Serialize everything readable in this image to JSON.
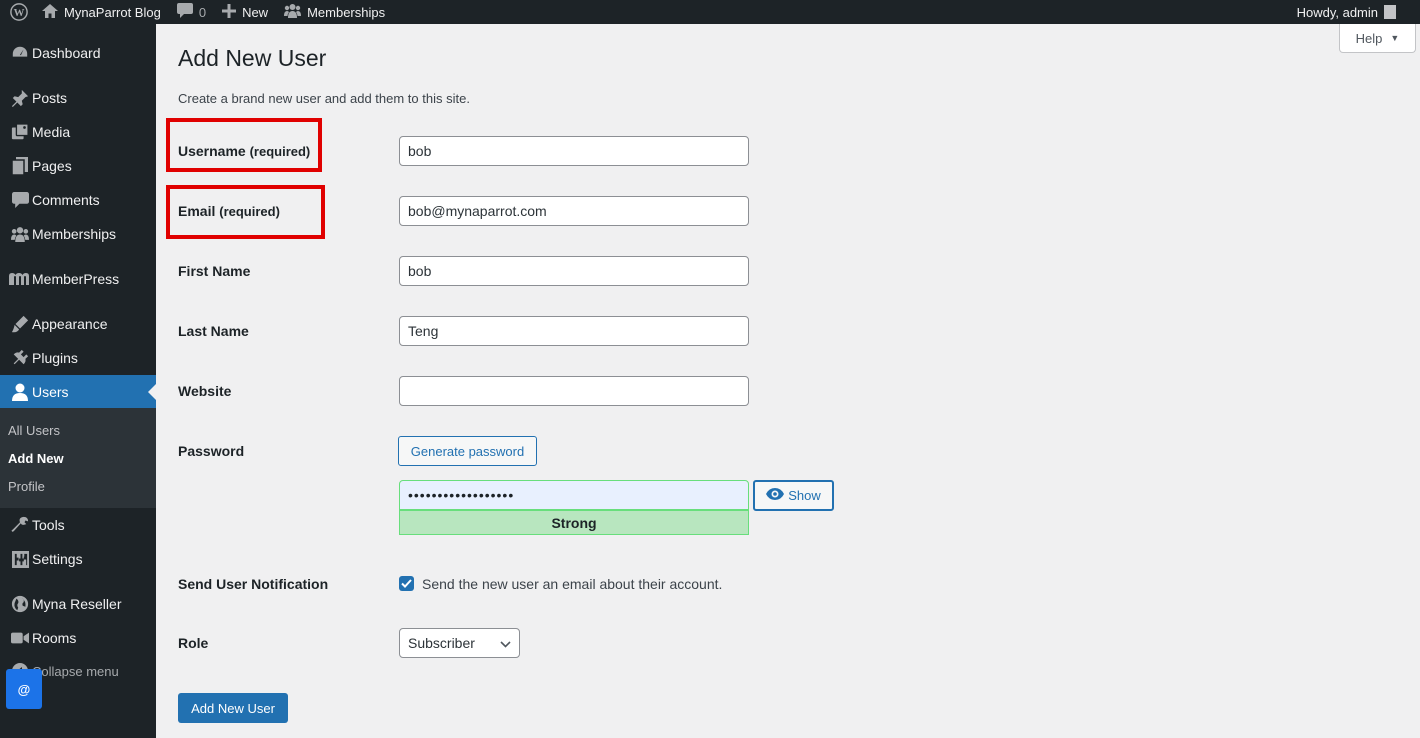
{
  "adminbar": {
    "site_name": "MynaParrot Blog",
    "comments_count": "0",
    "new_label": "New",
    "memberships_label": "Memberships",
    "howdy": "Howdy, admin"
  },
  "sidebar": {
    "items": [
      {
        "label": "Dashboard",
        "icon": "dashboard-icon"
      },
      {
        "label": "Posts",
        "icon": "pin-icon"
      },
      {
        "label": "Media",
        "icon": "media-icon"
      },
      {
        "label": "Pages",
        "icon": "pages-icon"
      },
      {
        "label": "Comments",
        "icon": "comment-icon"
      },
      {
        "label": "Memberships",
        "icon": "groups-icon"
      },
      {
        "label": "MemberPress",
        "icon": "memberpress-icon"
      },
      {
        "label": "Appearance",
        "icon": "brush-icon"
      },
      {
        "label": "Plugins",
        "icon": "plugin-icon"
      },
      {
        "label": "Users",
        "icon": "user-icon"
      },
      {
        "label": "Tools",
        "icon": "wrench-icon"
      },
      {
        "label": "Settings",
        "icon": "sliders-icon"
      },
      {
        "label": "Myna Reseller",
        "icon": "globe-icon"
      },
      {
        "label": "Rooms",
        "icon": "video-icon"
      }
    ],
    "submenu": [
      {
        "label": "All Users"
      },
      {
        "label": "Add New"
      },
      {
        "label": "Profile"
      }
    ],
    "collapse_label": "Collapse menu",
    "widget_label": "@"
  },
  "help_label": "Help",
  "page": {
    "title": "Add New User",
    "description": "Create a brand new user and add them to this site."
  },
  "form": {
    "username": {
      "label": "Username",
      "required": "(required)",
      "value": "bob"
    },
    "email": {
      "label": "Email",
      "required": "(required)",
      "value": "bob@mynaparrot.com"
    },
    "first_name": {
      "label": "First Name",
      "value": "bob"
    },
    "last_name": {
      "label": "Last Name",
      "value": "Teng"
    },
    "website": {
      "label": "Website",
      "value": ""
    },
    "password": {
      "label": "Password",
      "generate_label": "Generate password",
      "masked_value": "••••••••••••••••••",
      "strength": "Strong",
      "show_label": "Show"
    },
    "notification": {
      "label": "Send User Notification",
      "checked": true,
      "text": "Send the new user an email about their account."
    },
    "role": {
      "label": "Role",
      "selected": "Subscriber"
    },
    "submit_label": "Add New User"
  },
  "colors": {
    "admin_bar": "#1d2327",
    "accent": "#2271b1",
    "annotation": "#e00000",
    "strength_strong": "#b8e6bf"
  }
}
